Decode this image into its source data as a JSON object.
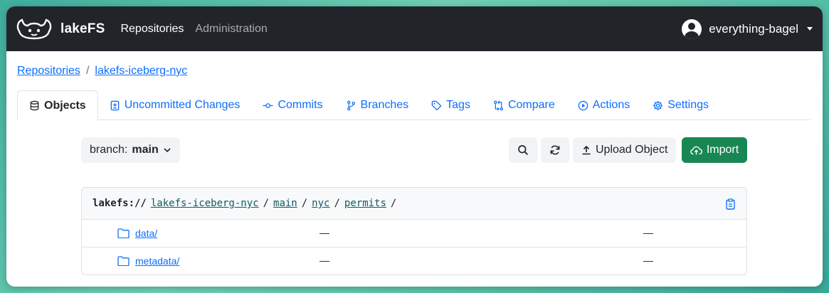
{
  "navbar": {
    "brand": "lakeFS",
    "links": [
      "Repositories",
      "Administration"
    ],
    "user": "everything-bagel"
  },
  "breadcrumb": {
    "root": "Repositories",
    "sep": "/",
    "repo": "lakefs-iceberg-nyc"
  },
  "tabs": [
    "Objects",
    "Uncommitted Changes",
    "Commits",
    "Branches",
    "Tags",
    "Compare",
    "Actions",
    "Settings"
  ],
  "toolbar": {
    "branch_prefix": "branch:",
    "branch_name": "main",
    "upload_label": "Upload Object",
    "import_label": "Import"
  },
  "path": {
    "scheme": "lakefs://",
    "segments": [
      "lakefs-iceberg-nyc",
      "main",
      "nyc",
      "permits"
    ],
    "sep": "/"
  },
  "rows": [
    {
      "name": "data/",
      "col2": "—",
      "col3": "—"
    },
    {
      "name": "metadata/",
      "col2": "—",
      "col3": "—"
    }
  ],
  "colors": {
    "navbar": "#212529",
    "link": "#0d6efd",
    "import": "#198754"
  }
}
